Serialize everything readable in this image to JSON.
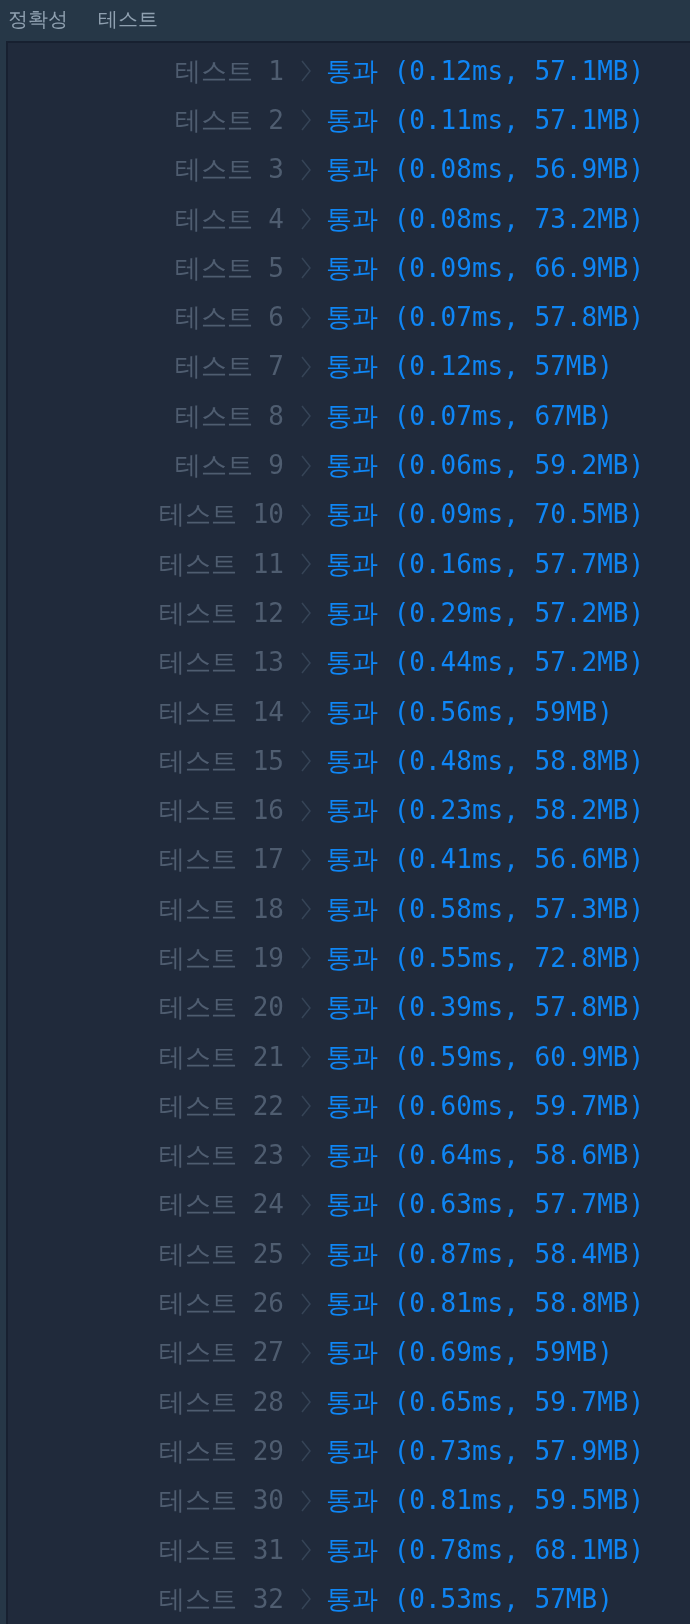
{
  "header": {
    "items": [
      "정확성",
      "테스트"
    ]
  },
  "results": [
    {
      "label": "테스트 1",
      "status": "통과",
      "detail": "(0.12ms, 57.1MB)"
    },
    {
      "label": "테스트 2",
      "status": "통과",
      "detail": "(0.11ms, 57.1MB)"
    },
    {
      "label": "테스트 3",
      "status": "통과",
      "detail": "(0.08ms, 56.9MB)"
    },
    {
      "label": "테스트 4",
      "status": "통과",
      "detail": "(0.08ms, 73.2MB)"
    },
    {
      "label": "테스트 5",
      "status": "통과",
      "detail": "(0.09ms, 66.9MB)"
    },
    {
      "label": "테스트 6",
      "status": "통과",
      "detail": "(0.07ms, 57.8MB)"
    },
    {
      "label": "테스트 7",
      "status": "통과",
      "detail": "(0.12ms, 57MB)"
    },
    {
      "label": "테스트 8",
      "status": "통과",
      "detail": "(0.07ms, 67MB)"
    },
    {
      "label": "테스트 9",
      "status": "통과",
      "detail": "(0.06ms, 59.2MB)"
    },
    {
      "label": "테스트 10",
      "status": "통과",
      "detail": "(0.09ms, 70.5MB)"
    },
    {
      "label": "테스트 11",
      "status": "통과",
      "detail": "(0.16ms, 57.7MB)"
    },
    {
      "label": "테스트 12",
      "status": "통과",
      "detail": "(0.29ms, 57.2MB)"
    },
    {
      "label": "테스트 13",
      "status": "통과",
      "detail": "(0.44ms, 57.2MB)"
    },
    {
      "label": "테스트 14",
      "status": "통과",
      "detail": "(0.56ms, 59MB)"
    },
    {
      "label": "테스트 15",
      "status": "통과",
      "detail": "(0.48ms, 58.8MB)"
    },
    {
      "label": "테스트 16",
      "status": "통과",
      "detail": "(0.23ms, 58.2MB)"
    },
    {
      "label": "테스트 17",
      "status": "통과",
      "detail": "(0.41ms, 56.6MB)"
    },
    {
      "label": "테스트 18",
      "status": "통과",
      "detail": "(0.58ms, 57.3MB)"
    },
    {
      "label": "테스트 19",
      "status": "통과",
      "detail": "(0.55ms, 72.8MB)"
    },
    {
      "label": "테스트 20",
      "status": "통과",
      "detail": "(0.39ms, 57.8MB)"
    },
    {
      "label": "테스트 21",
      "status": "통과",
      "detail": "(0.59ms, 60.9MB)"
    },
    {
      "label": "테스트 22",
      "status": "통과",
      "detail": "(0.60ms, 59.7MB)"
    },
    {
      "label": "테스트 23",
      "status": "통과",
      "detail": "(0.64ms, 58.6MB)"
    },
    {
      "label": "테스트 24",
      "status": "통과",
      "detail": "(0.63ms, 57.7MB)"
    },
    {
      "label": "테스트 25",
      "status": "통과",
      "detail": "(0.87ms, 58.4MB)"
    },
    {
      "label": "테스트 26",
      "status": "통과",
      "detail": "(0.81ms, 58.8MB)"
    },
    {
      "label": "테스트 27",
      "status": "통과",
      "detail": "(0.69ms, 59MB)"
    },
    {
      "label": "테스트 28",
      "status": "통과",
      "detail": "(0.65ms, 59.7MB)"
    },
    {
      "label": "테스트 29",
      "status": "통과",
      "detail": "(0.73ms, 57.9MB)"
    },
    {
      "label": "테스트 30",
      "status": "통과",
      "detail": "(0.81ms, 59.5MB)"
    },
    {
      "label": "테스트 31",
      "status": "통과",
      "detail": "(0.78ms, 68.1MB)"
    },
    {
      "label": "테스트 32",
      "status": "통과",
      "detail": "(0.53ms, 57MB)"
    }
  ]
}
